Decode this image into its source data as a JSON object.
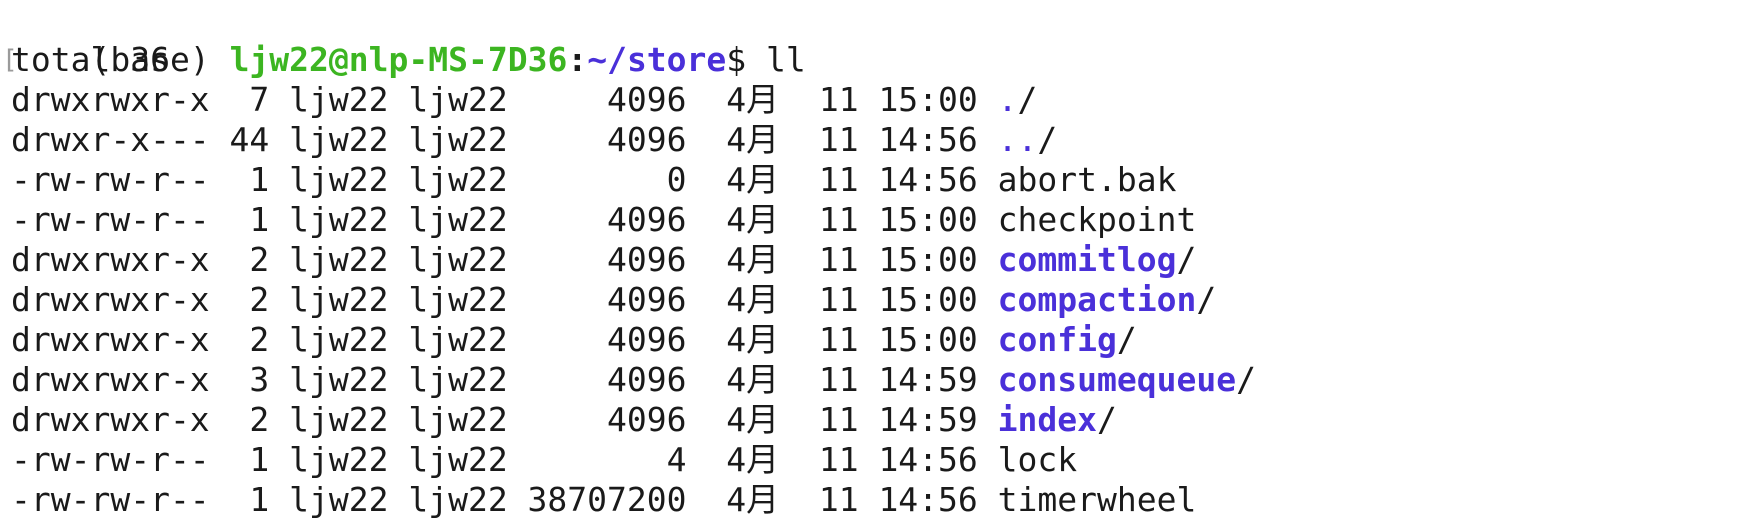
{
  "terminal": {
    "prompt": {
      "env": "(base) ",
      "user_host": "ljw22@nlp-MS-7D36",
      "sep": ":",
      "path": "~/store",
      "symbol": "$ ",
      "command": "ll"
    },
    "total": "total 36",
    "entries": [
      {
        "meta": "drwxrwxr-x  7 ljw22 ljw22     4096  4月  11 15:00 ",
        "name": ".",
        "suffix": "/"
      },
      {
        "meta": "drwxr-x--- 44 ljw22 ljw22     4096  4月  11 14:56 ",
        "name": "..",
        "suffix": "/"
      },
      {
        "meta": "-rw-rw-r--  1 ljw22 ljw22        0  4月  11 14:56 ",
        "name": "abort.bak",
        "suffix": ""
      },
      {
        "meta": "-rw-rw-r--  1 ljw22 ljw22     4096  4月  11 15:00 ",
        "name": "checkpoint",
        "suffix": ""
      },
      {
        "meta": "drwxrwxr-x  2 ljw22 ljw22     4096  4月  11 15:00 ",
        "name": "commitlog",
        "suffix": "/"
      },
      {
        "meta": "drwxrwxr-x  2 ljw22 ljw22     4096  4月  11 15:00 ",
        "name": "compaction",
        "suffix": "/"
      },
      {
        "meta": "drwxrwxr-x  2 ljw22 ljw22     4096  4月  11 15:00 ",
        "name": "config",
        "suffix": "/"
      },
      {
        "meta": "drwxrwxr-x  3 ljw22 ljw22     4096  4月  11 14:59 ",
        "name": "consumequeue",
        "suffix": "/"
      },
      {
        "meta": "drwxrwxr-x  2 ljw22 ljw22     4096  4月  11 14:59 ",
        "name": "index",
        "suffix": "/"
      },
      {
        "meta": "-rw-rw-r--  1 ljw22 ljw22        4  4月  11 14:56 ",
        "name": "lock",
        "suffix": ""
      },
      {
        "meta": "-rw-rw-r--  1 ljw22 ljw22 38707200  4月  11 14:56 ",
        "name": "timerwheel",
        "suffix": ""
      }
    ],
    "colors": {
      "user_host": "#3cb521",
      "path": "#4a30d9",
      "directory": "#4a30d9",
      "text": "#1a1a1a",
      "background": "#ffffff"
    }
  }
}
